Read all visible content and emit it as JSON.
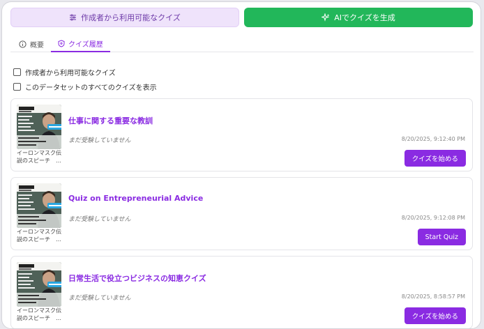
{
  "header": {
    "available_button_label": "作成者から利用可能なクイズ",
    "ai_button_label": "AIでクイズを生成"
  },
  "tabs": [
    {
      "label": "概要",
      "icon": "info-icon"
    },
    {
      "label": "クイズ履歴",
      "icon": "shield-icon",
      "active": true
    }
  ],
  "filters": [
    {
      "label": "作成者から利用可能なクイズ",
      "checked": false
    },
    {
      "label": "このデータセットのすべてのクイズを表示",
      "checked": false
    }
  ],
  "quizzes": [
    {
      "title": "仕事に関する重要な教訓",
      "status": "まだ受験していません",
      "date": "8/20/2025, 9:12:40 PM",
      "button": "クイズを始める",
      "thumb_label_line1": "イーロンマスク伝",
      "thumb_label_line2": "説のスピーチ　…"
    },
    {
      "title": "Quiz on Entrepreneurial Advice",
      "status": "まだ受験していません",
      "date": "8/20/2025, 9:12:08 PM",
      "button": "Start Quiz",
      "thumb_label_line1": "イーロンマスク伝",
      "thumb_label_line2": "説のスピーチ　…"
    },
    {
      "title": "日常生活で役立つビジネスの知恵クイズ",
      "status": "まだ受験していません",
      "date": "8/20/2025, 8:58:57 PM",
      "button": "クイズを始める",
      "thumb_label_line1": "イーロンマスク伝",
      "thumb_label_line2": "説のスピーチ　…"
    }
  ],
  "colors": {
    "accent": "#8a2be2",
    "ai_green": "#22b75a",
    "soft_purple": "#efe3fb"
  }
}
